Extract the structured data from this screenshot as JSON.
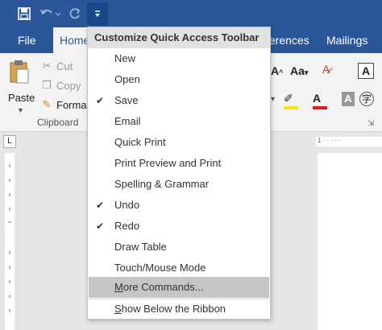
{
  "qat": {
    "save_icon": "save-icon",
    "undo_icon": "undo-icon",
    "redo_icon": "redo-icon",
    "customize_icon": "customize-qat-icon"
  },
  "tabs": {
    "file": "File",
    "home": "Home",
    "references": "ferences",
    "mailings": "Mailings"
  },
  "clipboard": {
    "paste": "Paste",
    "cut": "Cut",
    "copy": "Copy",
    "format_painter": "Format",
    "group_label": "Clipboard"
  },
  "ruler": {
    "tab_glyph": "L",
    "marks": "1 · · · · ·"
  },
  "dropdown": {
    "header": "Customize Quick Access Toolbar",
    "items": [
      {
        "label": "New",
        "checked": false
      },
      {
        "label": "Open",
        "checked": false
      },
      {
        "label": "Save",
        "checked": true
      },
      {
        "label": "Email",
        "checked": false
      },
      {
        "label": "Quick Print",
        "checked": false
      },
      {
        "label": "Print Preview and Print",
        "checked": false
      },
      {
        "label": "Spelling & Grammar",
        "checked": false
      },
      {
        "label": "Undo",
        "checked": true
      },
      {
        "label": "Redo",
        "checked": true
      },
      {
        "label": "Draw Table",
        "checked": false
      },
      {
        "label": "Touch/Mouse Mode",
        "checked": false
      }
    ],
    "more_commands": {
      "access_key": "M",
      "rest": "ore Commands..."
    },
    "show_below": {
      "access_key": "S",
      "rest": "how Below the Ribbon"
    }
  },
  "colors": {
    "title_bar": "#2b579a",
    "highlight": "#f1e60f",
    "font_color": "#e01b1b",
    "hover_item": "#c5c5c5"
  }
}
